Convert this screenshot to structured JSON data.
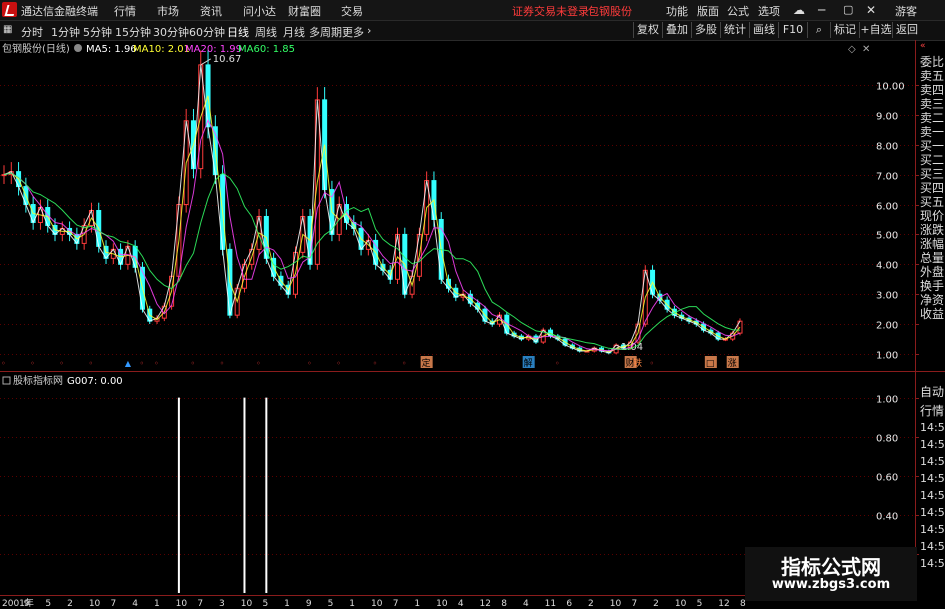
{
  "titlebar": {
    "app_title": "通达信金融终端",
    "menus": [
      "行情",
      "市场",
      "资讯",
      "问小达",
      "财富圈",
      "交易"
    ],
    "status": "证券交易未登录",
    "stock": "包钢股份",
    "right_items": [
      "功能",
      "版面",
      "公式",
      "选项"
    ],
    "guest": "游客"
  },
  "toolbar": {
    "periods": [
      "分时",
      "1分钟",
      "5分钟",
      "15分钟",
      "30分钟",
      "60分钟",
      "日线",
      "周线",
      "月线",
      "多周期",
      "更多"
    ],
    "active_period": "日线",
    "right_buttons": [
      "复权",
      "叠加",
      "多股",
      "统计",
      "画线",
      "F10",
      "标记",
      "+自选",
      "返回"
    ]
  },
  "sidepanel": {
    "items": [
      "委比",
      "卖五",
      "卖四",
      "卖三",
      "卖二",
      "卖一",
      "买一",
      "买二",
      "买三",
      "买四",
      "买五",
      "现价",
      "涨跌",
      "涨幅",
      "总量",
      "外盘",
      "换手",
      "净资",
      "收益"
    ],
    "lower_items": [
      "自动",
      "行情",
      "14:5",
      "14:5",
      "14:5",
      "14:5",
      "14:5",
      "14:5",
      "14:5",
      "14:5",
      "14:5"
    ]
  },
  "watermark": {
    "line1": "指标公式网",
    "line2": "www.zbgs3.com"
  },
  "colors": {
    "ma5": "#ffffff",
    "ma10": "#ffff33",
    "ma20": "#ff44ff",
    "ma60": "#33ff66",
    "up": "#ff3b3b",
    "down": "#33ffff",
    "grid": "#5a0000",
    "axis": "#8a1c1c"
  },
  "chart_data": [
    {
      "type": "line",
      "title": "包钢股份(日线)",
      "legend": [
        {
          "name": "MA5",
          "value": "1.96"
        },
        {
          "name": "MA10",
          "value": "2.01"
        },
        {
          "name": "MA20",
          "value": "1.99"
        },
        {
          "name": "MA60",
          "value": "1.85"
        }
      ],
      "ylim": [
        0.6,
        10.9
      ],
      "yticks": [
        "10.00",
        "9.00",
        "8.00",
        "7.00",
        "6.00",
        "5.00",
        "4.00",
        "3.00",
        "2.00",
        "1.00"
      ],
      "annotations": [
        {
          "text": "10.67",
          "y": 10.67,
          "x_index": 27
        },
        {
          "text": "1.04",
          "y": 1.04,
          "x_index": 83
        }
      ],
      "x_labels": [
        "2001年",
        "9",
        "5",
        "2",
        "10",
        "7",
        "4",
        "1",
        "10",
        "7",
        "3",
        "10",
        "5",
        "1",
        "9",
        "5",
        "1",
        "10",
        "7",
        "1",
        "10",
        "4",
        "12",
        "8",
        "4",
        "11",
        "6",
        "2",
        "10",
        "7",
        "2",
        "10",
        "5",
        "12",
        "8"
      ],
      "markers": [
        {
          "x_index": 0,
          "kind": "s"
        },
        {
          "x_index": 4,
          "kind": "s"
        },
        {
          "x_index": 8,
          "kind": "s"
        },
        {
          "x_index": 12,
          "kind": "s"
        },
        {
          "x_index": 17,
          "kind": "up"
        },
        {
          "x_index": 19,
          "kind": "s"
        },
        {
          "x_index": 21,
          "kind": "s"
        },
        {
          "x_index": 26,
          "kind": "s"
        },
        {
          "x_index": 30,
          "kind": "s"
        },
        {
          "x_index": 35,
          "kind": "s"
        },
        {
          "x_index": 42,
          "kind": "s"
        },
        {
          "x_index": 46,
          "kind": "s"
        },
        {
          "x_index": 51,
          "kind": "s"
        },
        {
          "x_index": 55,
          "kind": "s"
        },
        {
          "x_index": 58,
          "kind": "box",
          "text": "定"
        },
        {
          "x_index": 72,
          "kind": "box",
          "text": "解"
        },
        {
          "x_index": 76,
          "kind": "s"
        },
        {
          "x_index": 86,
          "kind": "box",
          "text": "财"
        },
        {
          "x_index": 87,
          "kind": "label",
          "text": "铁"
        },
        {
          "x_index": 89,
          "kind": "s"
        },
        {
          "x_index": 97,
          "kind": "box",
          "text": "□"
        },
        {
          "x_index": 100,
          "kind": "box",
          "text": "涨"
        }
      ],
      "prices": [
        7.0,
        7.1,
        6.6,
        6.0,
        5.4,
        5.9,
        5.3,
        5.0,
        5.2,
        5.0,
        4.7,
        5.3,
        5.8,
        4.6,
        4.2,
        4.5,
        4.0,
        4.6,
        3.9,
        2.5,
        2.1,
        2.2,
        2.6,
        3.6,
        6.0,
        8.8,
        7.2,
        10.67,
        8.6,
        7.0,
        4.5,
        2.3,
        3.2,
        4.0,
        4.5,
        5.6,
        4.2,
        3.6,
        3.3,
        3.0,
        4.4,
        5.6,
        4.0,
        9.5,
        6.5,
        5.0,
        6.0,
        5.4,
        5.2,
        4.5,
        4.8,
        4.0,
        3.8,
        3.5,
        5.0,
        3.0,
        3.6,
        5.0,
        6.8,
        5.5,
        3.5,
        3.2,
        2.9,
        3.0,
        2.7,
        2.5,
        2.1,
        2.0,
        2.3,
        1.7,
        1.6,
        1.5,
        1.6,
        1.4,
        1.8,
        1.6,
        1.5,
        1.3,
        1.2,
        1.1,
        1.1,
        1.2,
        1.1,
        1.04,
        1.3,
        1.2,
        1.4,
        2.0,
        3.8,
        3.0,
        2.8,
        2.5,
        2.3,
        2.2,
        2.1,
        2.0,
        1.8,
        1.7,
        1.5,
        1.5,
        1.7,
        2.1
      ]
    },
    {
      "type": "bar",
      "title": "股标指标网",
      "legend": [
        {
          "name": "G007",
          "value": "0.00"
        }
      ],
      "ylim": [
        0,
        1.07
      ],
      "yticks": [
        "1.00",
        "0.80",
        "0.60",
        "0.40",
        "0.20"
      ],
      "signals": [
        {
          "x_index": 24,
          "value": 1.0
        },
        {
          "x_index": 33,
          "value": 1.0
        },
        {
          "x_index": 36,
          "value": 1.0
        }
      ]
    }
  ]
}
